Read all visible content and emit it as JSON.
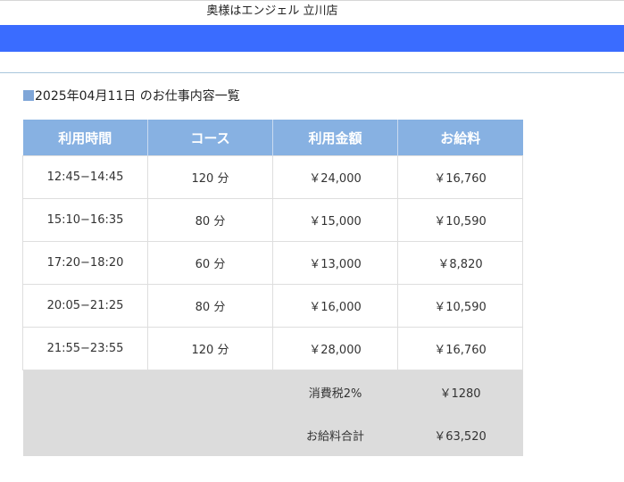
{
  "header": {
    "shop_title": "奥様はエンジェル 立川店"
  },
  "section": {
    "heading": "2025年04月11日 のお仕事内容一覧"
  },
  "table": {
    "columns": [
      "利用時間",
      "コース",
      "利用金額",
      "お給料"
    ],
    "rows": [
      {
        "time": "12:45−14:45",
        "course": "120 分",
        "amount": "￥24,000",
        "pay": "￥16,760"
      },
      {
        "time": "15:10−16:35",
        "course": "80 分",
        "amount": "￥15,000",
        "pay": "￥10,590"
      },
      {
        "time": "17:20−18:20",
        "course": "60 分",
        "amount": "￥13,000",
        "pay": "￥8,820"
      },
      {
        "time": "20:05−21:25",
        "course": "80 分",
        "amount": "￥16,000",
        "pay": "￥10,590"
      },
      {
        "time": "21:55−23:55",
        "course": "120 分",
        "amount": "￥28,000",
        "pay": "￥16,760"
      }
    ],
    "summary": [
      {
        "label": "消費税2%",
        "value": "￥1280"
      },
      {
        "label": "お給料合計",
        "value": "￥63,520"
      }
    ]
  },
  "colors": {
    "blue_bar": "#3a6cff",
    "table_header": "#87b1e2",
    "summary_bg": "#dcdcdc",
    "heading_square": "#7fa6d8"
  }
}
